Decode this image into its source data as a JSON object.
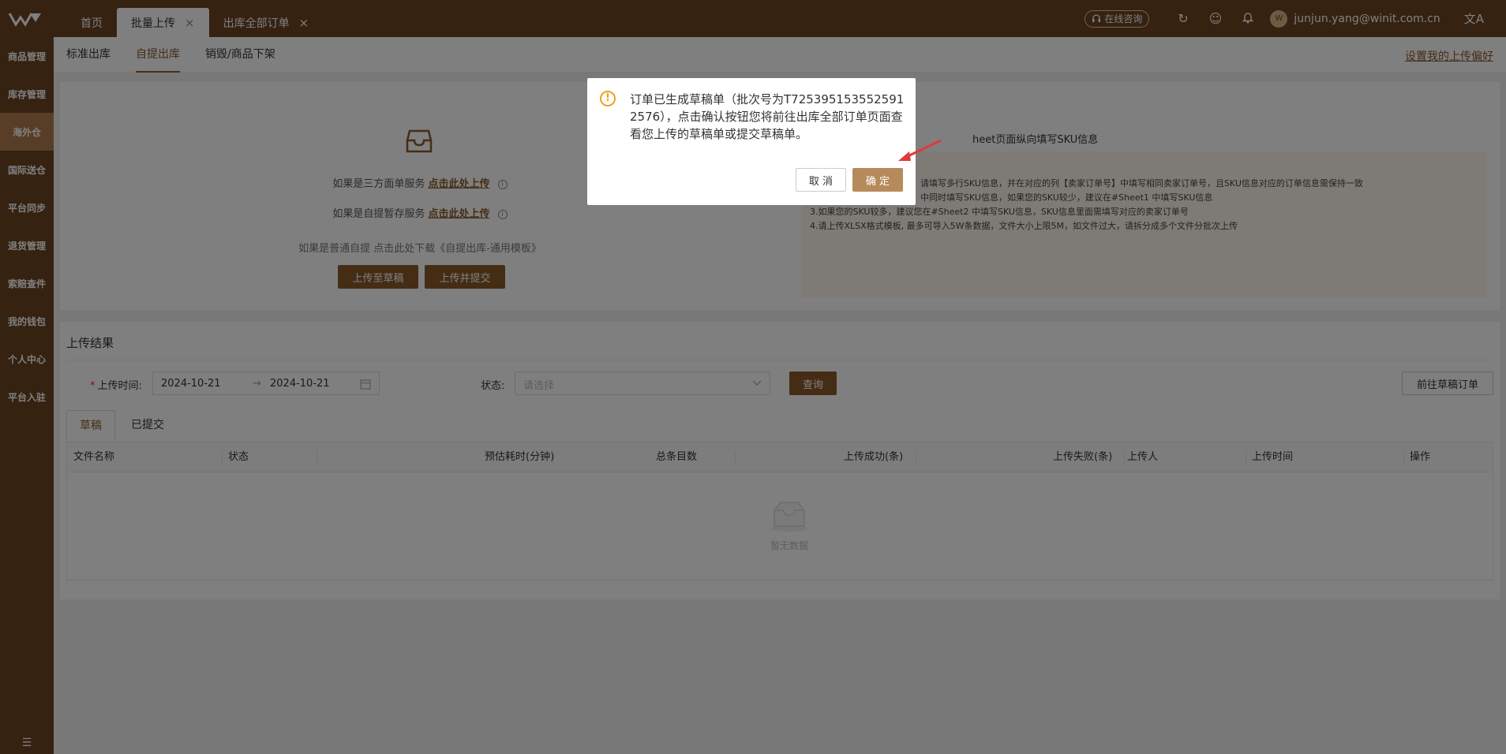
{
  "topbar": {
    "tabs": [
      {
        "label": "首页",
        "closable": false,
        "active": false
      },
      {
        "label": "批量上传",
        "closable": true,
        "active": true
      },
      {
        "label": "出库全部订单",
        "closable": true,
        "active": false
      }
    ],
    "consult": "在线咨询",
    "user": "junjun.yang@winit.com.cn",
    "close_glyph": "×"
  },
  "sidebar": {
    "items": [
      "商品管理",
      "库存管理",
      "海外仓",
      "国际送仓",
      "平台同步",
      "退货管理",
      "索赔查件",
      "我的钱包",
      "个人中心",
      "平台入驻"
    ],
    "active_index": 2
  },
  "subnav": {
    "tabs": [
      "标准出库",
      "自提出库",
      "销毁/商品下架"
    ],
    "active_index": 1,
    "pref_link": "设置我的上传偏好"
  },
  "upload": {
    "line1_text": "如果是三方面单服务",
    "line1_link": "点击此处上传",
    "line2_text": "如果是自提暂存服务",
    "line2_link": "点击此处上传",
    "line3": "如果是普通自提 点击此处下载《自提出库-通用模板》",
    "btn_draft": "上传至草稿",
    "btn_submit": "上传并提交",
    "tips_title": "heet页面纵向填写SKU信息",
    "tips": [
      "请填写多行SKU信息，并在对应的列【卖家订单号】中填写相同卖家订单号，且SKU信息对应的订单信息需保持一致",
      "中同时填写SKU信息，如果您的SKU较少，建议在#Sheet1 中填写SKU信息",
      "3.如果您的SKU较多，建议您在#Sheet2 中填写SKU信息，SKU信息里面需填写对应的卖家订单号",
      "4.请上传XLSX格式模板, 最多可导入5W条数据，文件大小上限5M，如文件过大，请拆分成多个文件分批次上传"
    ]
  },
  "result": {
    "title": "上传结果",
    "date_label": "上传时间:",
    "date_from": "2024-10-21",
    "date_to": "2024-10-21",
    "status_label": "状态:",
    "status_placeholder": "请选择",
    "query_btn": "查询",
    "goto_btn": "前往草稿订单",
    "tabs": [
      "草稿",
      "已提交"
    ],
    "columns": [
      "文件名称",
      "状态",
      "预估耗时(分钟)",
      "总条目数",
      "上传成功(条)",
      "上传失败(条)",
      "上传人",
      "上传时间",
      "操作"
    ],
    "empty": "暂无数据"
  },
  "dialog": {
    "message": "订单已生成草稿单（批次号为T7253951535525912576），点击确认按钮您将前往出库全部订单页面查看您上传的草稿单或提交草稿单。",
    "cancel": "取 消",
    "ok": "确 定"
  },
  "colors": {
    "brand": "#6b4423",
    "accent": "#8b5a2b",
    "active_side": "#b07d4e",
    "warn": "#f0a020",
    "arrow": "#e03a3a"
  }
}
